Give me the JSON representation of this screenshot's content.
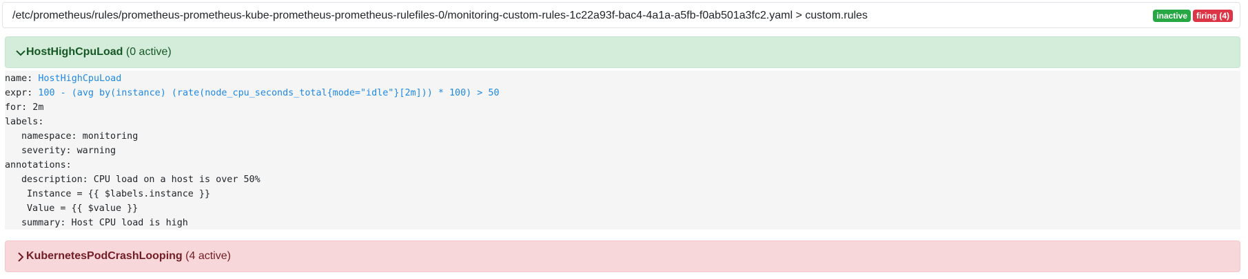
{
  "group_header": {
    "path": "/etc/prometheus/rules/prometheus-prometheus-kube-prometheus-prometheus-rulefiles-0/monitoring-custom-rules-1c22a93f-bac4-4a1a-a5fb-f0ab501a3fc2.yaml > custom.rules",
    "badges": {
      "inactive": "inactive",
      "firing": "firing (4)"
    }
  },
  "rules": [
    {
      "name": "HostHighCpuLoad",
      "active_text": "(0 active)",
      "state": "inactive",
      "expanded": true,
      "detail": {
        "name_key": "name:",
        "name_value": "HostHighCpuLoad",
        "expr_key": "expr:",
        "expr_value": "100 - (avg by(instance) (rate(node_cpu_seconds_total{mode=\"idle\"}[2m])) * 100) > 50",
        "for_line": "for: 2m",
        "labels_key": "labels:",
        "labels": [
          "namespace: monitoring",
          "severity: warning"
        ],
        "annotations_key": "annotations:",
        "description_line": "description: CPU load on a host is over 50%",
        "description_cont": [
          "Instance = {{ $labels.instance }}",
          "Value = {{ $value }}"
        ],
        "summary_line": "summary: Host CPU load is high"
      }
    },
    {
      "name": "KubernetesPodCrashLooping",
      "active_text": "(4 active)",
      "state": "firing",
      "expanded": false
    }
  ],
  "colors": {
    "inactive_bg": "#d4edda",
    "inactive_text": "#155724",
    "firing_bg": "#f8d7da",
    "firing_text": "#721c24",
    "badge_inactive": "#28a745",
    "badge_firing": "#dc3545",
    "value_blue": "#1e88e5"
  },
  "icons": {
    "expanded": "chevron-down-icon",
    "collapsed": "chevron-right-icon"
  }
}
